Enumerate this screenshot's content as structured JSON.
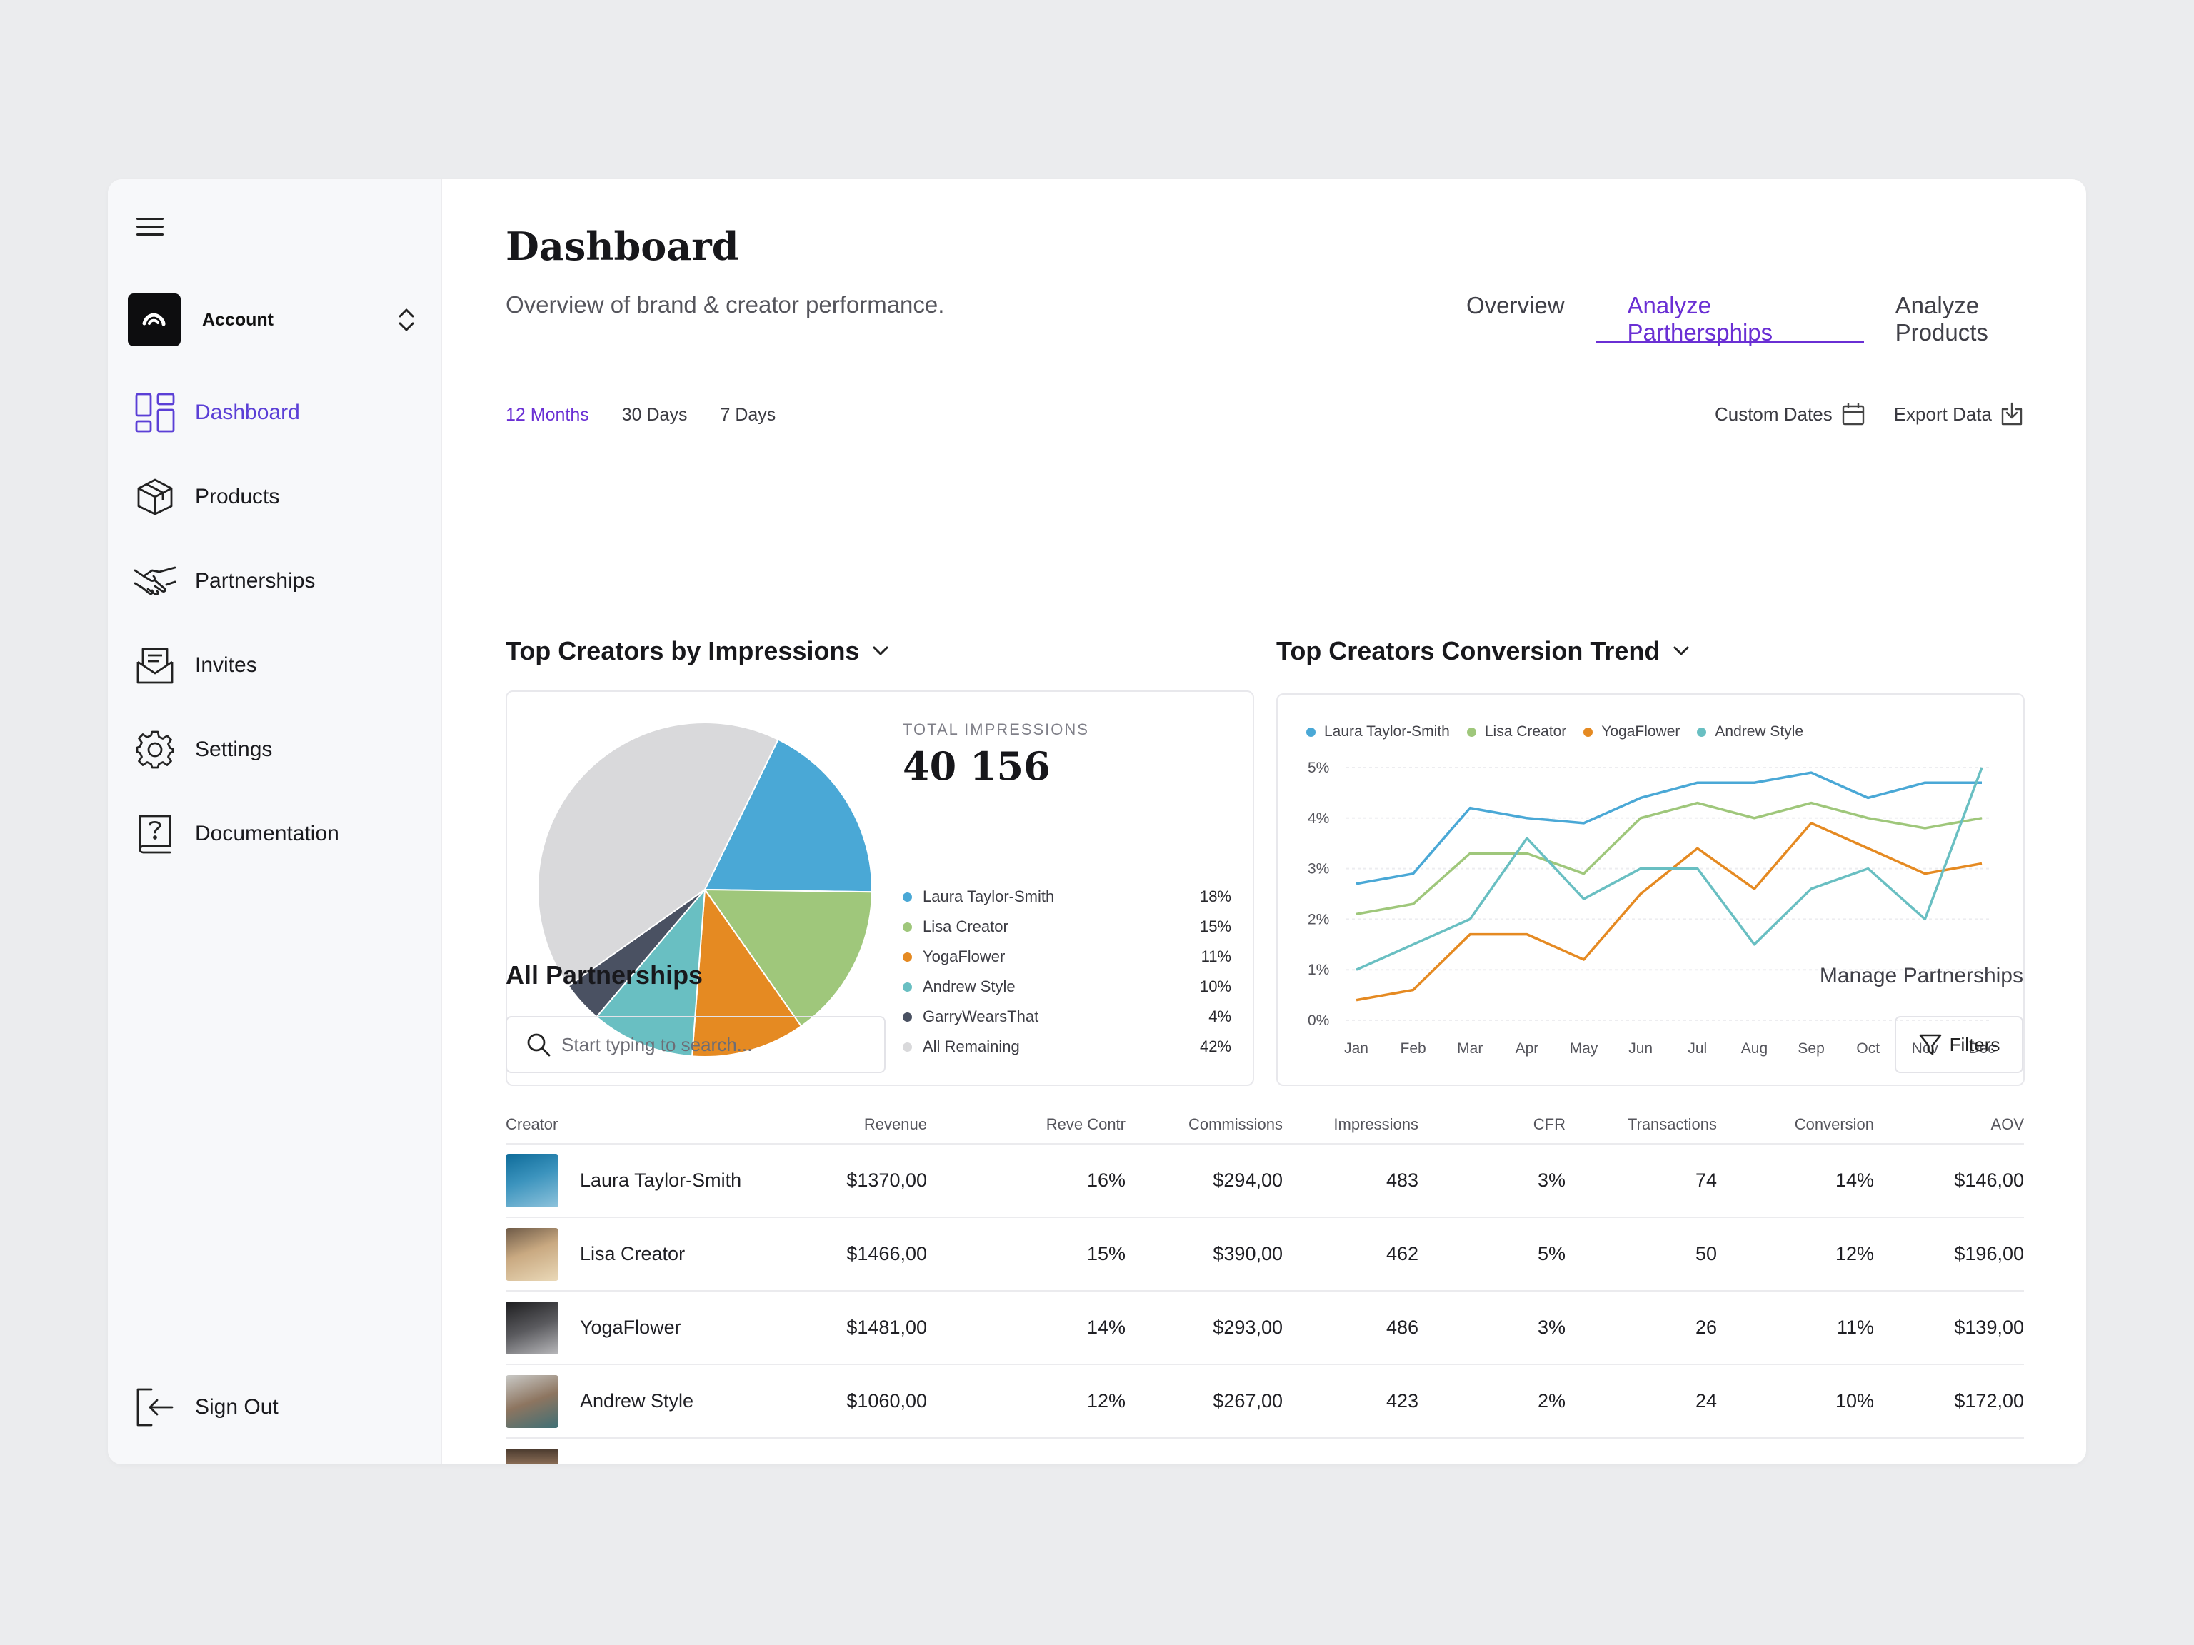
{
  "sidebar": {
    "account_label": "Account",
    "nav": [
      {
        "label": "Dashboard",
        "icon": "dashboard-icon",
        "active": true
      },
      {
        "label": "Products",
        "icon": "box-icon"
      },
      {
        "label": "Partnerships",
        "icon": "handshake-icon"
      },
      {
        "label": "Invites",
        "icon": "mail-icon"
      },
      {
        "label": "Settings",
        "icon": "gear-icon"
      },
      {
        "label": "Documentation",
        "icon": "help-book-icon"
      }
    ],
    "signout_label": "Sign Out"
  },
  "header": {
    "title": "Dashboard",
    "subtitle": "Overview of brand & creator performance.",
    "tabs": [
      {
        "label": "Overview"
      },
      {
        "label": "Analyze Parthersphips",
        "active": true
      },
      {
        "label": "Analyze Products"
      }
    ]
  },
  "filters": {
    "ranges": [
      "12 Months",
      "30 Days",
      "7 Days"
    ],
    "active_range": "12 Months",
    "custom_dates": "Custom Dates",
    "export_data": "Export Data"
  },
  "impressions": {
    "title": "Top Creators by Impressions",
    "total_label": "TOTAL IMPRESSIONS",
    "total_value": "40 156"
  },
  "trend": {
    "title": "Top Creators Conversion Trend"
  },
  "chart_data": [
    {
      "type": "pie",
      "categories": [
        "Laura Taylor-Smith",
        "Lisa Creator",
        "YogaFlower",
        "Andrew Style",
        "GarryWearsThat",
        "All Remaining"
      ],
      "values": [
        18,
        15,
        11,
        10,
        4,
        42
      ],
      "value_labels": [
        "18%",
        "15%",
        "11%",
        "10%",
        "4%",
        "42%"
      ],
      "colors": [
        "#4aa8d6",
        "#9fc77b",
        "#e58a22",
        "#69bfc2",
        "#4a5162",
        "#d9d9db"
      ],
      "legend": "right"
    },
    {
      "type": "line",
      "x": [
        "Jan",
        "Feb",
        "Mar",
        "Apr",
        "May",
        "Jun",
        "Jul",
        "Aug",
        "Sep",
        "Oct",
        "Nov",
        "Dec"
      ],
      "yticks": [
        "0%",
        "1%",
        "2%",
        "3%",
        "4%",
        "5%"
      ],
      "ylim": [
        0,
        5
      ],
      "grid": true,
      "legend": "top-left",
      "series": [
        {
          "name": "Laura Taylor-Smith",
          "color": "#4aa8d6",
          "values": [
            2.7,
            2.9,
            4.2,
            4.0,
            3.9,
            4.4,
            4.7,
            4.7,
            4.9,
            4.4,
            4.7,
            4.7
          ]
        },
        {
          "name": "Lisa Creator",
          "color": "#9fc77b",
          "values": [
            2.1,
            2.3,
            3.3,
            3.3,
            2.9,
            4.0,
            4.3,
            4.0,
            4.3,
            4.0,
            3.8,
            4.0
          ]
        },
        {
          "name": "YogaFlower",
          "color": "#e58a22",
          "values": [
            0.4,
            0.6,
            1.7,
            1.7,
            1.2,
            2.5,
            3.4,
            2.6,
            3.9,
            3.4,
            2.9,
            3.1
          ]
        },
        {
          "name": "Andrew Style",
          "color": "#69bfc2",
          "values": [
            1.0,
            1.5,
            2.0,
            3.6,
            2.4,
            3.0,
            3.0,
            1.5,
            2.6,
            3.0,
            2.0,
            5.0
          ]
        }
      ]
    }
  ],
  "partnerships": {
    "title": "All Partnerships",
    "manage": "Manage Partnerships",
    "search_placeholder": "Start typing to search...",
    "filters_label": "Filters",
    "columns": [
      "Creator",
      "Revenue",
      "Reve Contr",
      "Commissions",
      "Impressions",
      "CFR",
      "Transactions",
      "Conversion",
      "AOV"
    ],
    "rows": [
      {
        "creator": "Laura Taylor-Smith",
        "revenue": "$1370,00",
        "rc": "16%",
        "commissions": "$294,00",
        "impressions": "483",
        "cfr": "3%",
        "transactions": "74",
        "conversion": "14%",
        "aov": "$146,00"
      },
      {
        "creator": "Lisa Creator",
        "revenue": "$1466,00",
        "rc": "15%",
        "commissions": "$390,00",
        "impressions": "462",
        "cfr": "5%",
        "transactions": "50",
        "conversion": "12%",
        "aov": "$196,00"
      },
      {
        "creator": "YogaFlower",
        "revenue": "$1481,00",
        "rc": "14%",
        "commissions": "$293,00",
        "impressions": "486",
        "cfr": "3%",
        "transactions": "26",
        "conversion": "11%",
        "aov": "$139,00"
      },
      {
        "creator": "Andrew Style",
        "revenue": "$1060,00",
        "rc": "12%",
        "commissions": "$267,00",
        "impressions": "423",
        "cfr": "2%",
        "transactions": "24",
        "conversion": "10%",
        "aov": "$172,00"
      }
    ]
  }
}
